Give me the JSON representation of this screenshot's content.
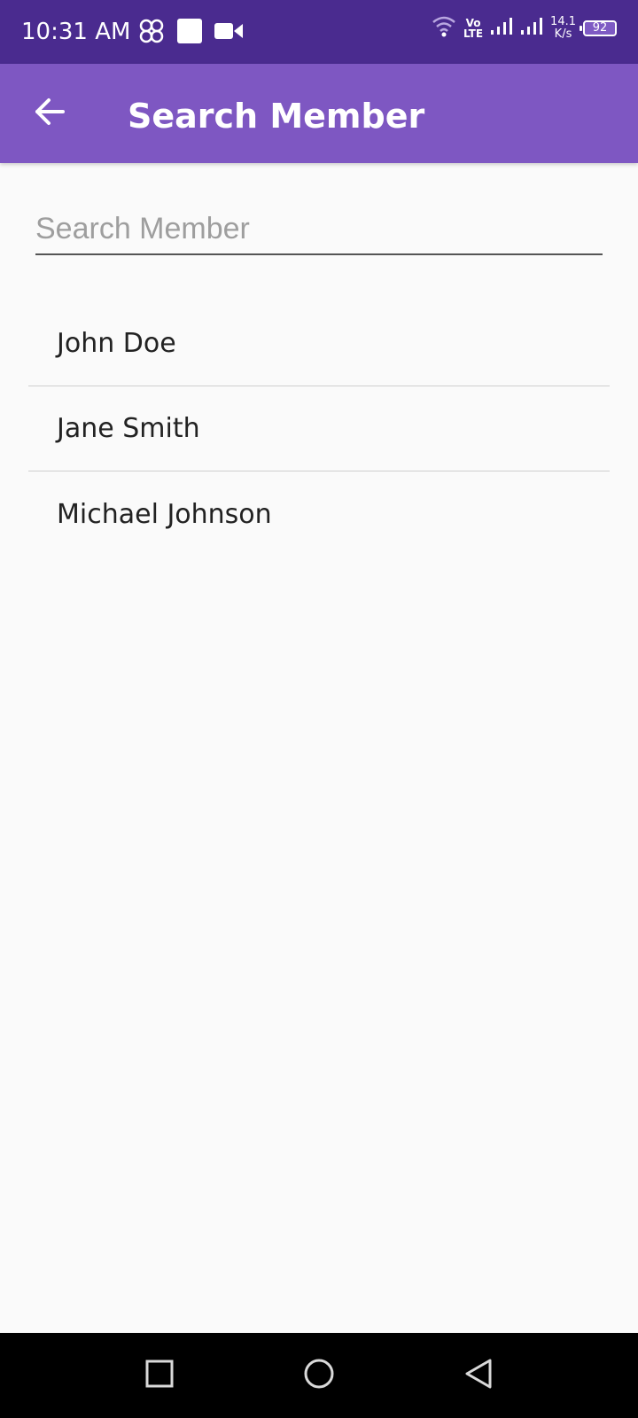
{
  "status_bar": {
    "time": "10:31 AM",
    "volte_top": "Vo",
    "volte_bottom": "LTE",
    "speed_value": "14.1",
    "speed_unit": "K/s",
    "battery": "92",
    "icons": [
      "link-icon",
      "square-icon",
      "video-icon",
      "wifi-icon",
      "signal-icon",
      "signal-icon",
      "battery-icon"
    ]
  },
  "app_bar": {
    "title": "Search Member",
    "back_icon": "arrow-left-icon"
  },
  "search": {
    "placeholder": "Search Member",
    "value": ""
  },
  "members": [
    {
      "name": "John Doe"
    },
    {
      "name": "Jane Smith"
    },
    {
      "name": "Michael Johnson"
    }
  ],
  "nav_bar": {
    "buttons": [
      "recents-icon",
      "home-icon",
      "back-icon"
    ]
  },
  "colors": {
    "status_bar": "#4a2b8f",
    "app_bar": "#7e57c2",
    "background": "#fafafa",
    "nav_bar": "#000000"
  }
}
